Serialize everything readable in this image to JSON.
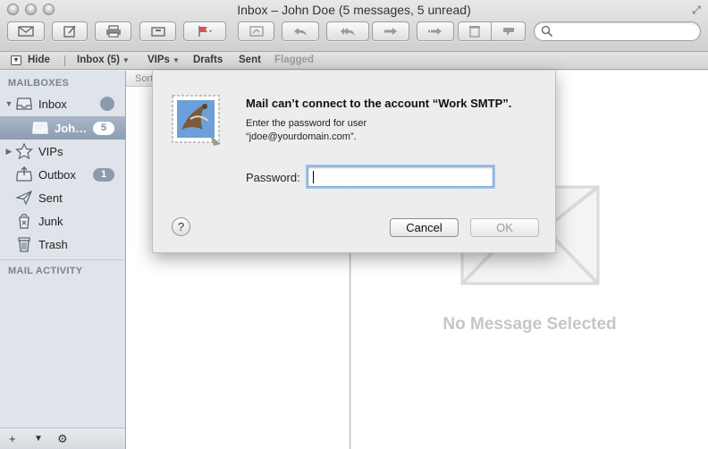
{
  "window": {
    "title": "Inbox – John Doe (5 messages, 5 unread)"
  },
  "toolbar": {
    "buttons": [
      "get-mail-icon",
      "compose-icon",
      "print-icon",
      "archive-icon",
      "flag-icon",
      "notes-icon",
      "reply-icon",
      "reply-all-icon",
      "forward-icon",
      "redirect-icon",
      "trash-icon",
      "junk-icon"
    ],
    "search_placeholder": ""
  },
  "favorites": {
    "hide_label": "Hide",
    "inbox_label": "Inbox (5)",
    "vips_label": "VIPs",
    "drafts_label": "Drafts",
    "sent_label": "Sent",
    "flagged_label": "Flagged"
  },
  "sidebar": {
    "mailboxes_header": "MAILBOXES",
    "items": [
      {
        "label": "Inbox",
        "icon": "inbox-icon"
      },
      {
        "label": "Joh…",
        "badge": "5",
        "icon": "account-icon"
      },
      {
        "label": "VIPs",
        "icon": "star-icon"
      },
      {
        "label": "Outbox",
        "badge": "1",
        "icon": "outbox-icon"
      },
      {
        "label": "Sent",
        "icon": "paper-plane-icon"
      },
      {
        "label": "Junk",
        "icon": "junk-bin-icon"
      },
      {
        "label": "Trash",
        "icon": "trash-icon"
      }
    ],
    "activity_header": "MAIL ACTIVITY",
    "bottom": {
      "add": "+",
      "show": "▼",
      "action": "⚙"
    }
  },
  "message_list": {
    "sort_label": "Sort by Date"
  },
  "viewer": {
    "empty_text": "No Message Selected"
  },
  "dialog": {
    "title": "Mail can’t connect to the account “Work SMTP”.",
    "message_line1": "Enter the password for user",
    "message_line2": "“jdoe@yourdomain.com”.",
    "password_label": "Password:",
    "password_value": "",
    "help": "?",
    "cancel_label": "Cancel",
    "ok_label": "OK"
  },
  "colors": {
    "sidebar_bg": "#dfe4ea",
    "selection": "#93a3b7",
    "badge": "#8d9aae",
    "focus_ring": "#9cc2eb"
  }
}
